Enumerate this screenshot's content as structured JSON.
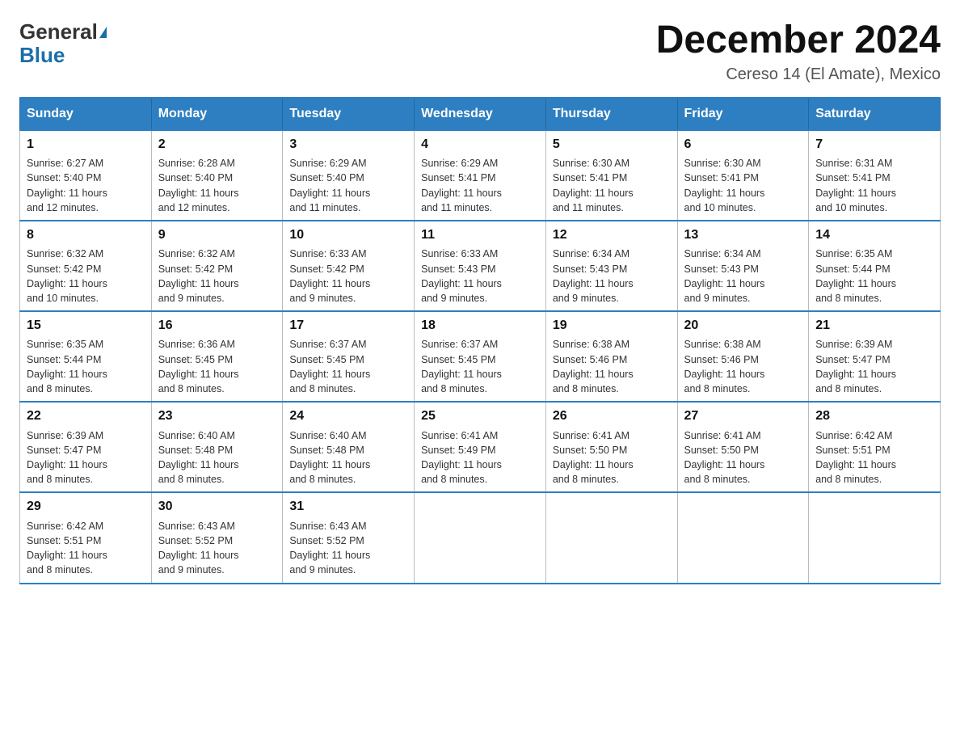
{
  "logo": {
    "general": "General",
    "blue": "Blue"
  },
  "title": "December 2024",
  "location": "Cereso 14 (El Amate), Mexico",
  "days_of_week": [
    "Sunday",
    "Monday",
    "Tuesday",
    "Wednesday",
    "Thursday",
    "Friday",
    "Saturday"
  ],
  "weeks": [
    [
      {
        "day": "1",
        "sunrise": "6:27 AM",
        "sunset": "5:40 PM",
        "daylight": "11 hours and 12 minutes."
      },
      {
        "day": "2",
        "sunrise": "6:28 AM",
        "sunset": "5:40 PM",
        "daylight": "11 hours and 12 minutes."
      },
      {
        "day": "3",
        "sunrise": "6:29 AM",
        "sunset": "5:40 PM",
        "daylight": "11 hours and 11 minutes."
      },
      {
        "day": "4",
        "sunrise": "6:29 AM",
        "sunset": "5:41 PM",
        "daylight": "11 hours and 11 minutes."
      },
      {
        "day": "5",
        "sunrise": "6:30 AM",
        "sunset": "5:41 PM",
        "daylight": "11 hours and 11 minutes."
      },
      {
        "day": "6",
        "sunrise": "6:30 AM",
        "sunset": "5:41 PM",
        "daylight": "11 hours and 10 minutes."
      },
      {
        "day": "7",
        "sunrise": "6:31 AM",
        "sunset": "5:41 PM",
        "daylight": "11 hours and 10 minutes."
      }
    ],
    [
      {
        "day": "8",
        "sunrise": "6:32 AM",
        "sunset": "5:42 PM",
        "daylight": "11 hours and 10 minutes."
      },
      {
        "day": "9",
        "sunrise": "6:32 AM",
        "sunset": "5:42 PM",
        "daylight": "11 hours and 9 minutes."
      },
      {
        "day": "10",
        "sunrise": "6:33 AM",
        "sunset": "5:42 PM",
        "daylight": "11 hours and 9 minutes."
      },
      {
        "day": "11",
        "sunrise": "6:33 AM",
        "sunset": "5:43 PM",
        "daylight": "11 hours and 9 minutes."
      },
      {
        "day": "12",
        "sunrise": "6:34 AM",
        "sunset": "5:43 PM",
        "daylight": "11 hours and 9 minutes."
      },
      {
        "day": "13",
        "sunrise": "6:34 AM",
        "sunset": "5:43 PM",
        "daylight": "11 hours and 9 minutes."
      },
      {
        "day": "14",
        "sunrise": "6:35 AM",
        "sunset": "5:44 PM",
        "daylight": "11 hours and 8 minutes."
      }
    ],
    [
      {
        "day": "15",
        "sunrise": "6:35 AM",
        "sunset": "5:44 PM",
        "daylight": "11 hours and 8 minutes."
      },
      {
        "day": "16",
        "sunrise": "6:36 AM",
        "sunset": "5:45 PM",
        "daylight": "11 hours and 8 minutes."
      },
      {
        "day": "17",
        "sunrise": "6:37 AM",
        "sunset": "5:45 PM",
        "daylight": "11 hours and 8 minutes."
      },
      {
        "day": "18",
        "sunrise": "6:37 AM",
        "sunset": "5:45 PM",
        "daylight": "11 hours and 8 minutes."
      },
      {
        "day": "19",
        "sunrise": "6:38 AM",
        "sunset": "5:46 PM",
        "daylight": "11 hours and 8 minutes."
      },
      {
        "day": "20",
        "sunrise": "6:38 AM",
        "sunset": "5:46 PM",
        "daylight": "11 hours and 8 minutes."
      },
      {
        "day": "21",
        "sunrise": "6:39 AM",
        "sunset": "5:47 PM",
        "daylight": "11 hours and 8 minutes."
      }
    ],
    [
      {
        "day": "22",
        "sunrise": "6:39 AM",
        "sunset": "5:47 PM",
        "daylight": "11 hours and 8 minutes."
      },
      {
        "day": "23",
        "sunrise": "6:40 AM",
        "sunset": "5:48 PM",
        "daylight": "11 hours and 8 minutes."
      },
      {
        "day": "24",
        "sunrise": "6:40 AM",
        "sunset": "5:48 PM",
        "daylight": "11 hours and 8 minutes."
      },
      {
        "day": "25",
        "sunrise": "6:41 AM",
        "sunset": "5:49 PM",
        "daylight": "11 hours and 8 minutes."
      },
      {
        "day": "26",
        "sunrise": "6:41 AM",
        "sunset": "5:50 PM",
        "daylight": "11 hours and 8 minutes."
      },
      {
        "day": "27",
        "sunrise": "6:41 AM",
        "sunset": "5:50 PM",
        "daylight": "11 hours and 8 minutes."
      },
      {
        "day": "28",
        "sunrise": "6:42 AM",
        "sunset": "5:51 PM",
        "daylight": "11 hours and 8 minutes."
      }
    ],
    [
      {
        "day": "29",
        "sunrise": "6:42 AM",
        "sunset": "5:51 PM",
        "daylight": "11 hours and 8 minutes."
      },
      {
        "day": "30",
        "sunrise": "6:43 AM",
        "sunset": "5:52 PM",
        "daylight": "11 hours and 9 minutes."
      },
      {
        "day": "31",
        "sunrise": "6:43 AM",
        "sunset": "5:52 PM",
        "daylight": "11 hours and 9 minutes."
      },
      null,
      null,
      null,
      null
    ]
  ],
  "labels": {
    "sunrise": "Sunrise:",
    "sunset": "Sunset:",
    "daylight": "Daylight:"
  }
}
